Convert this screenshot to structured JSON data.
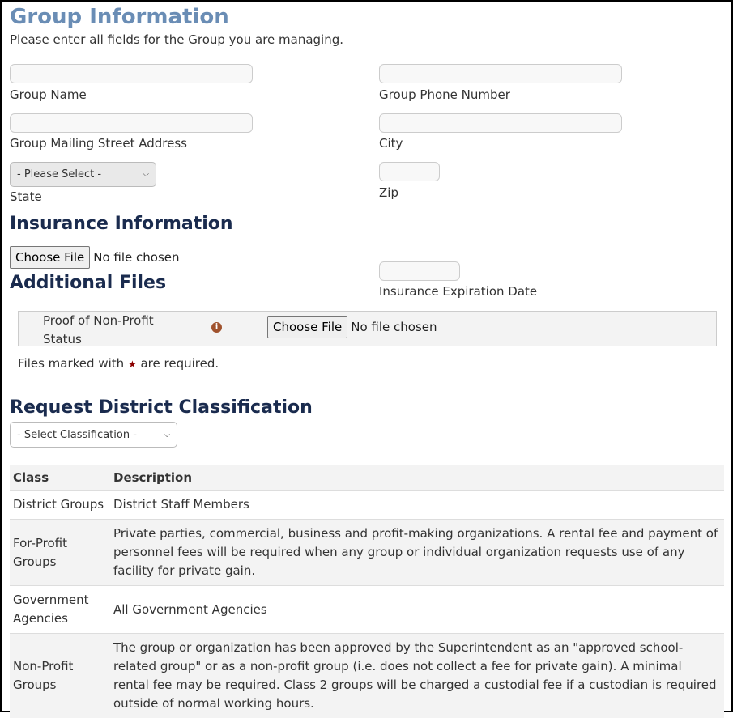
{
  "group": {
    "title": "Group Information",
    "subtitle": "Please enter all fields for the Group you are managing.",
    "fields": {
      "name_label": "Group Name",
      "phone_label": "Group Phone Number",
      "address_label": "Group Mailing Street Address",
      "city_label": "City",
      "state_label": "State",
      "state_value": "- Please Select -",
      "zip_label": "Zip"
    }
  },
  "insurance": {
    "title": "Insurance Information",
    "choose_file": "Choose File",
    "no_file": "No file chosen",
    "expiration_label": "Insurance Expiration Date"
  },
  "additional": {
    "title": "Additional Files",
    "row_label": "Proof of Non-Profit Status",
    "choose_file": "Choose File",
    "no_file": "No file chosen",
    "required_prefix": "Files marked with",
    "required_suffix": "are required."
  },
  "classification": {
    "title": "Request District Classification",
    "select_value": "- Select Classification -",
    "headers": {
      "class": "Class",
      "description": "Description"
    },
    "rows": [
      {
        "class": "District Groups",
        "description": "District Staff Members"
      },
      {
        "class": "For-Profit Groups",
        "description": "Private parties, commercial, business and profit-making organizations. A rental fee and payment of personnel fees will be required when any group or individual organization requests use of any facility for private gain."
      },
      {
        "class": "Government Agencies",
        "description": "All Government Agencies"
      },
      {
        "class": "Non-Profit Groups",
        "description": "The group or organization has been approved by the Superintendent as an \"approved school-related group\" or as a non-profit group (i.e. does not collect a fee for private gain). A minimal rental fee may be required. Class 2 groups will be charged a custodial fee if a custodian is required outside of normal working hours."
      }
    ]
  },
  "colors": {
    "title": "#6a8db5",
    "section": "#1a2b4e",
    "required_star": "#8b0000",
    "info_icon": "#a0522d"
  }
}
